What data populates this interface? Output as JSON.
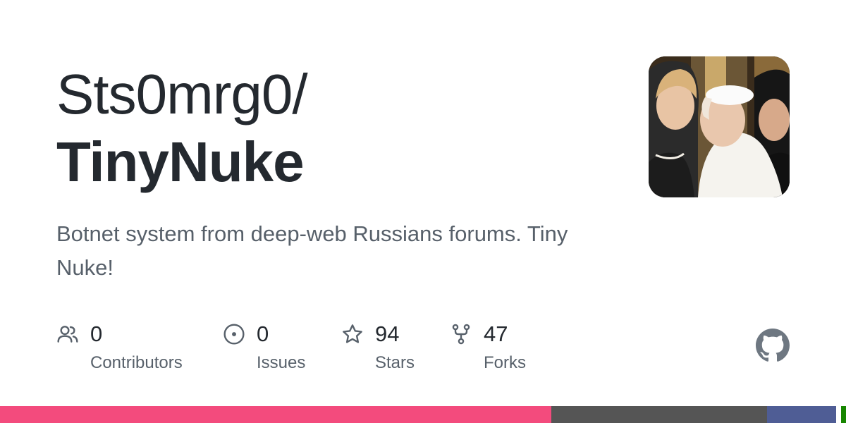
{
  "repo": {
    "owner": "Sts0mrg0/",
    "name": "TinyNuke",
    "description": "Botnet system from deep-web Russians forums. Tiny Nuke!"
  },
  "stats": {
    "contributors": {
      "value": "0",
      "label": "Contributors",
      "icon": "people-icon"
    },
    "issues": {
      "value": "0",
      "label": "Issues",
      "icon": "issue-opened-icon"
    },
    "stars": {
      "value": "94",
      "label": "Stars",
      "icon": "star-icon"
    },
    "forks": {
      "value": "47",
      "label": "Forks",
      "icon": "repo-forked-icon"
    }
  },
  "colors": {
    "title": "#24292f",
    "muted": "#57606a",
    "icon": "#57606a",
    "github_mark": "#6e7781"
  },
  "languages": [
    {
      "share": 0.652,
      "color": "#f34b7d"
    },
    {
      "share": 0.255,
      "color": "#555555"
    },
    {
      "share": 0.081,
      "color": "#4F5D95"
    },
    {
      "share": 0.006,
      "color": "#ffffff"
    },
    {
      "share": 0.006,
      "color": "#178600"
    }
  ]
}
